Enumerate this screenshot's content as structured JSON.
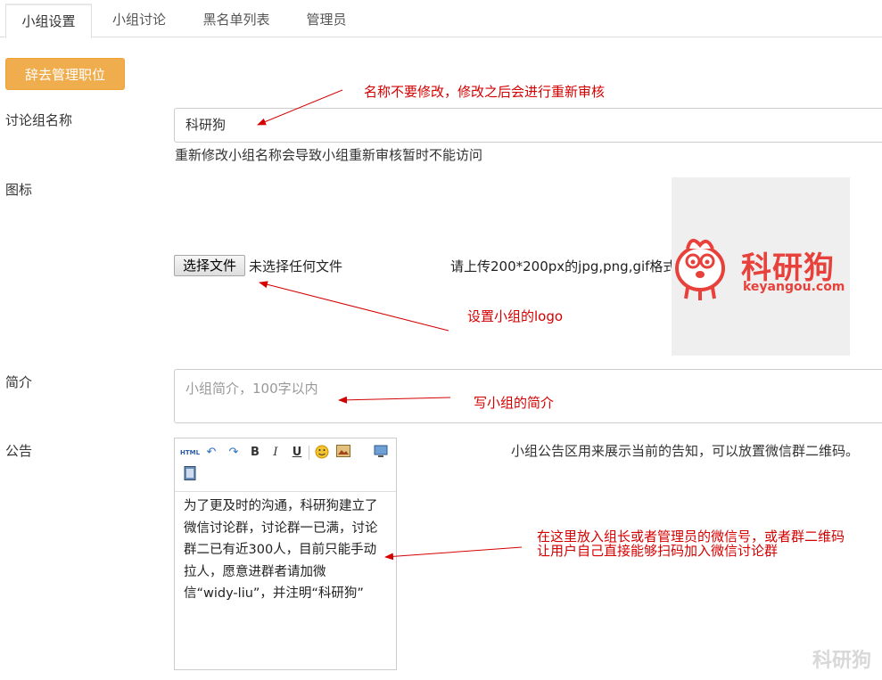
{
  "tabs": [
    {
      "label": "小组设置",
      "active": true
    },
    {
      "label": "小组讨论",
      "active": false
    },
    {
      "label": "黑名单列表",
      "active": false
    },
    {
      "label": "管理员",
      "active": false
    }
  ],
  "resign_button": "辞去管理职位",
  "fields": {
    "name": {
      "label": "讨论组名称",
      "value": "科研狗",
      "help": "重新修改小组名称会导致小组重新审核暂时不能访问"
    },
    "icon": {
      "label": "图标",
      "file_button": "选择文件",
      "file_status": "未选择任何文件",
      "hint": "请上传200*200px的jpg,png,gif格式",
      "logo_text": "科研狗",
      "logo_url_text": "keyangou.com"
    },
    "description": {
      "label": "简介",
      "placeholder": "小组简介，100字以内"
    },
    "announcement": {
      "label": "公告",
      "note": "小组公告区用来展示当前的告知，可以放置微信群二维码。",
      "content": "为了更及时的沟通，科研狗建立了微信讨论群，讨论群一已满，讨论群二已有近300人，目前只能手动拉人，愿意进群者请加微信“widy-liu”，并注明“科研狗”",
      "toolbar": [
        "html-icon",
        "undo-icon",
        "redo-icon",
        "bold-icon",
        "italic-icon",
        "underline-icon",
        "emoji-icon",
        "image-icon",
        "monitor-icon",
        "video-icon"
      ],
      "toolbar_labels": {
        "html": "HTML",
        "bold": "B",
        "italic": "I",
        "underline": "U"
      }
    }
  },
  "annotations": {
    "name": "名称不要修改，修改之后会进行重新审核",
    "logo": "设置小组的logo",
    "desc": "写小组的简介",
    "announcement_line1": "在这里放入组长或者管理员的微信号，或者群二维码",
    "announcement_line2": "让用户自己直接能够扫码加入微信讨论群"
  },
  "watermark": "科研狗",
  "colors": {
    "accent": "#f0ad4e",
    "annotation": "#d40000",
    "logo_red": "#e8413b"
  }
}
